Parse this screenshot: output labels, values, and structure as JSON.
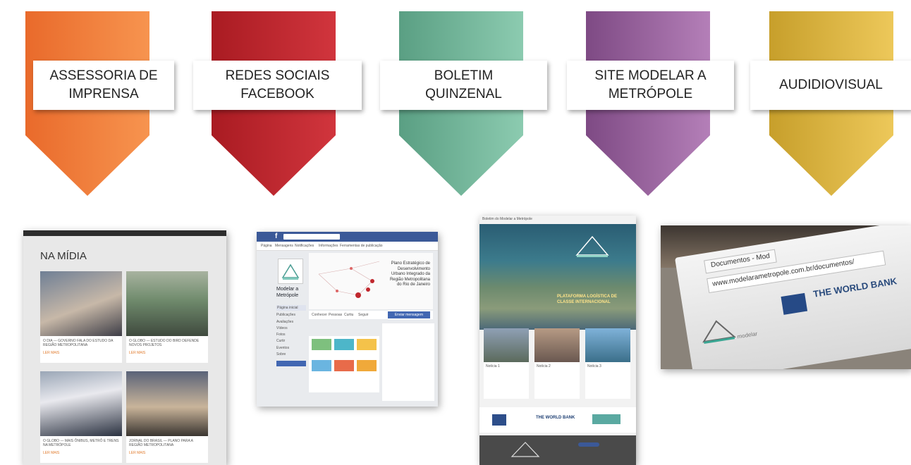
{
  "categories": [
    {
      "label_line1": "ASSESSORIA DE",
      "label_line2": "IMPRENSA",
      "color_top": "#e96a2b",
      "color_bottom": "#f7944f"
    },
    {
      "label_line1": "REDES SOCIAIS",
      "label_line2": "FACEBOOK",
      "color_top": "#a91b22",
      "color_bottom": "#d1353d"
    },
    {
      "label_line1": "BOLETIM",
      "label_line2": "QUINZENAL",
      "color_top": "#5a9f83",
      "color_bottom": "#8ccbb0"
    },
    {
      "label_line1": "SITE MODELAR A",
      "label_line2": "METRÓPOLE",
      "color_top": "#7e4a84",
      "color_bottom": "#b47fb8"
    },
    {
      "label_line1": "AUDIDIOVISUAL",
      "label_line2": "",
      "color_top": "#c79f2b",
      "color_bottom": "#edc85a"
    }
  ],
  "press": {
    "heading": "NA MÍDIA",
    "cards": [
      {
        "caption": "O DIA — GOVERNO FALA DO ESTUDO DA REGIÃO METROPOLITANA",
        "more": "LER MAIS"
      },
      {
        "caption": "O GLOBO — ESTUDO DO BIRD DEFENDE NOVOS PROJETOS",
        "more": "LER MAIS"
      },
      {
        "caption": "O GLOBO — MAIS ÔNIBUS, METRÔ E TRENS NA METRÓPOLE",
        "more": "LER MAIS"
      },
      {
        "caption": "JORNAL DO BRASIL — PLANO PARA A REGIÃO METROPOLITANA",
        "more": "LER MAIS"
      }
    ]
  },
  "facebook": {
    "page_name": "Modelar a Metrópole",
    "cover_text": "Plano Estratégico de Desenvolvimento Urbano Integrado da Região Metropolitana do Rio de Janeiro",
    "tabs": [
      "Página",
      "Mensagens",
      "Notificações",
      "Informações",
      "Ferramentas de publicação"
    ],
    "sidebar": [
      "Página inicial",
      "Publicações",
      "Avaliações",
      "Vídeos",
      "Fotos",
      "Curtir",
      "Eventos",
      "Sobre"
    ],
    "post_button": "Enviar mensagem",
    "menu": [
      "Conhecer",
      "Pessoas",
      "Curtiu",
      "Seguir"
    ]
  },
  "newsletter": {
    "header": "Boletim do Modelar a Metrópole",
    "headline": "PLATAFORMA LOGÍSTICA DE CLASSE INTERNACIONAL",
    "items": [
      "Notícia 1",
      "Notícia 2",
      "Notícia 3"
    ],
    "sponsor": "THE WORLD BANK"
  },
  "video": {
    "tab_title": "Documentos - Mod",
    "url": "www.modelarametropole.com.br/documentos/",
    "logo_text": "THE WORLD BANK",
    "brand": "modelar"
  }
}
